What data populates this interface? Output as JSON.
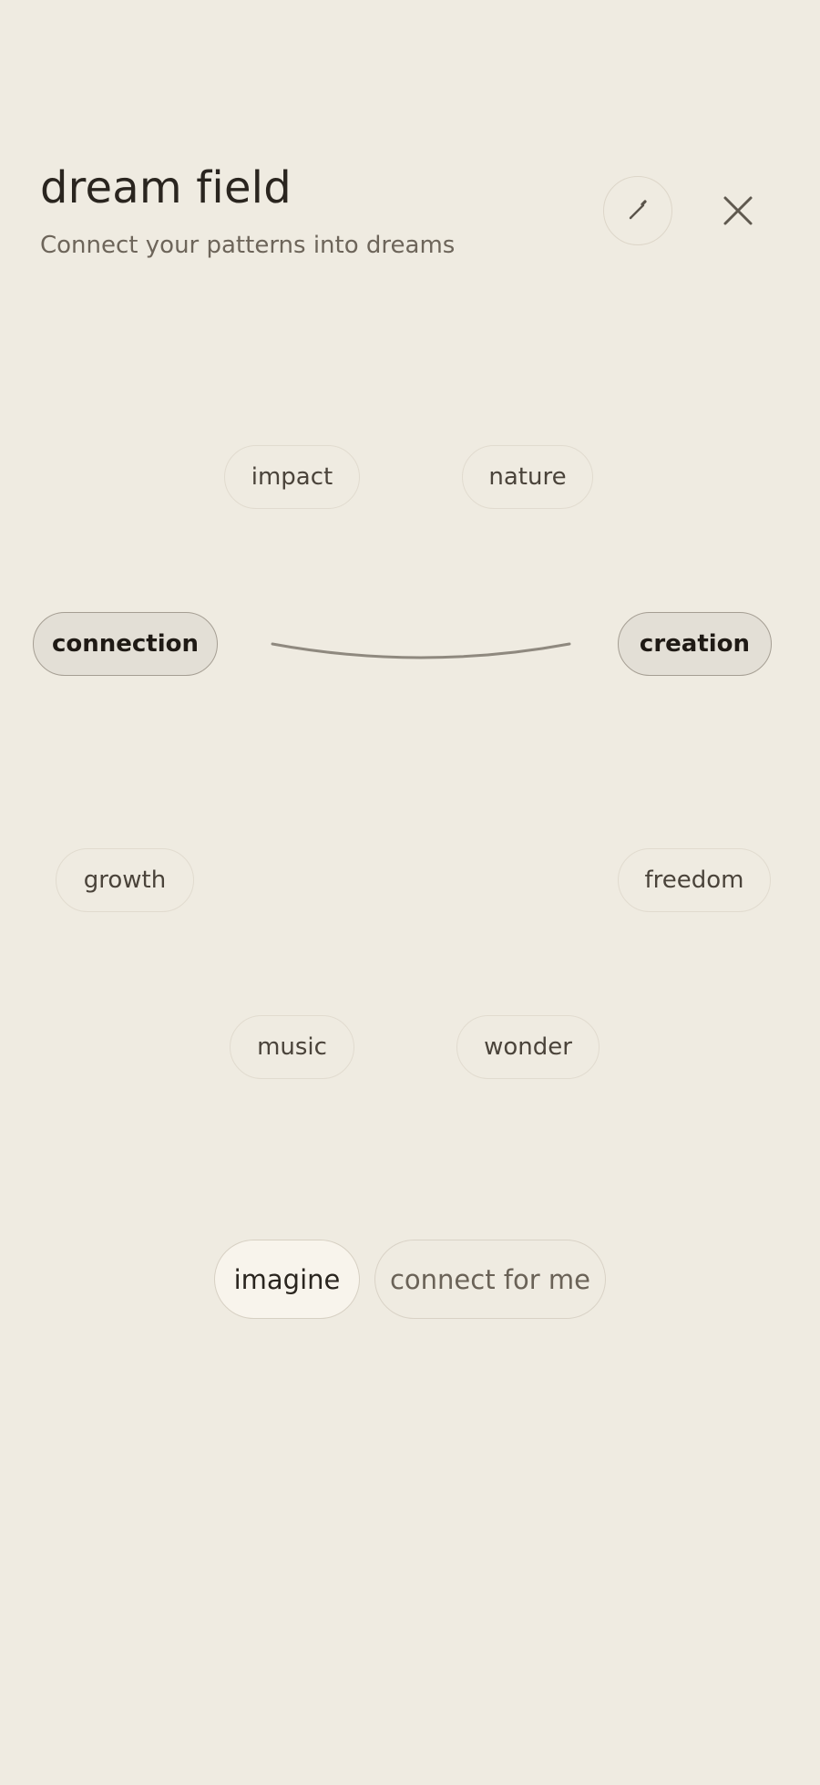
{
  "header": {
    "title": "dream field",
    "subtitle": "Connect your patterns into dreams",
    "edit_icon": "pencil-icon",
    "close_icon": "close-icon"
  },
  "field": {
    "chips": [
      {
        "label": "impact",
        "selected": false
      },
      {
        "label": "nature",
        "selected": false
      },
      {
        "label": "connection",
        "selected": true
      },
      {
        "label": "creation",
        "selected": true
      },
      {
        "label": "growth",
        "selected": false
      },
      {
        "label": "freedom",
        "selected": false
      },
      {
        "label": "music",
        "selected": false
      },
      {
        "label": "wonder",
        "selected": false
      }
    ],
    "connections": [
      {
        "from": "connection",
        "to": "creation"
      }
    ]
  },
  "actions": {
    "imagine_label": "imagine",
    "connect_label": "connect for me"
  },
  "colors": {
    "background": "#efebe1",
    "link_line": "#8f897f",
    "selected_fill": "#e3dfd6",
    "selected_border": "#a59e93"
  }
}
